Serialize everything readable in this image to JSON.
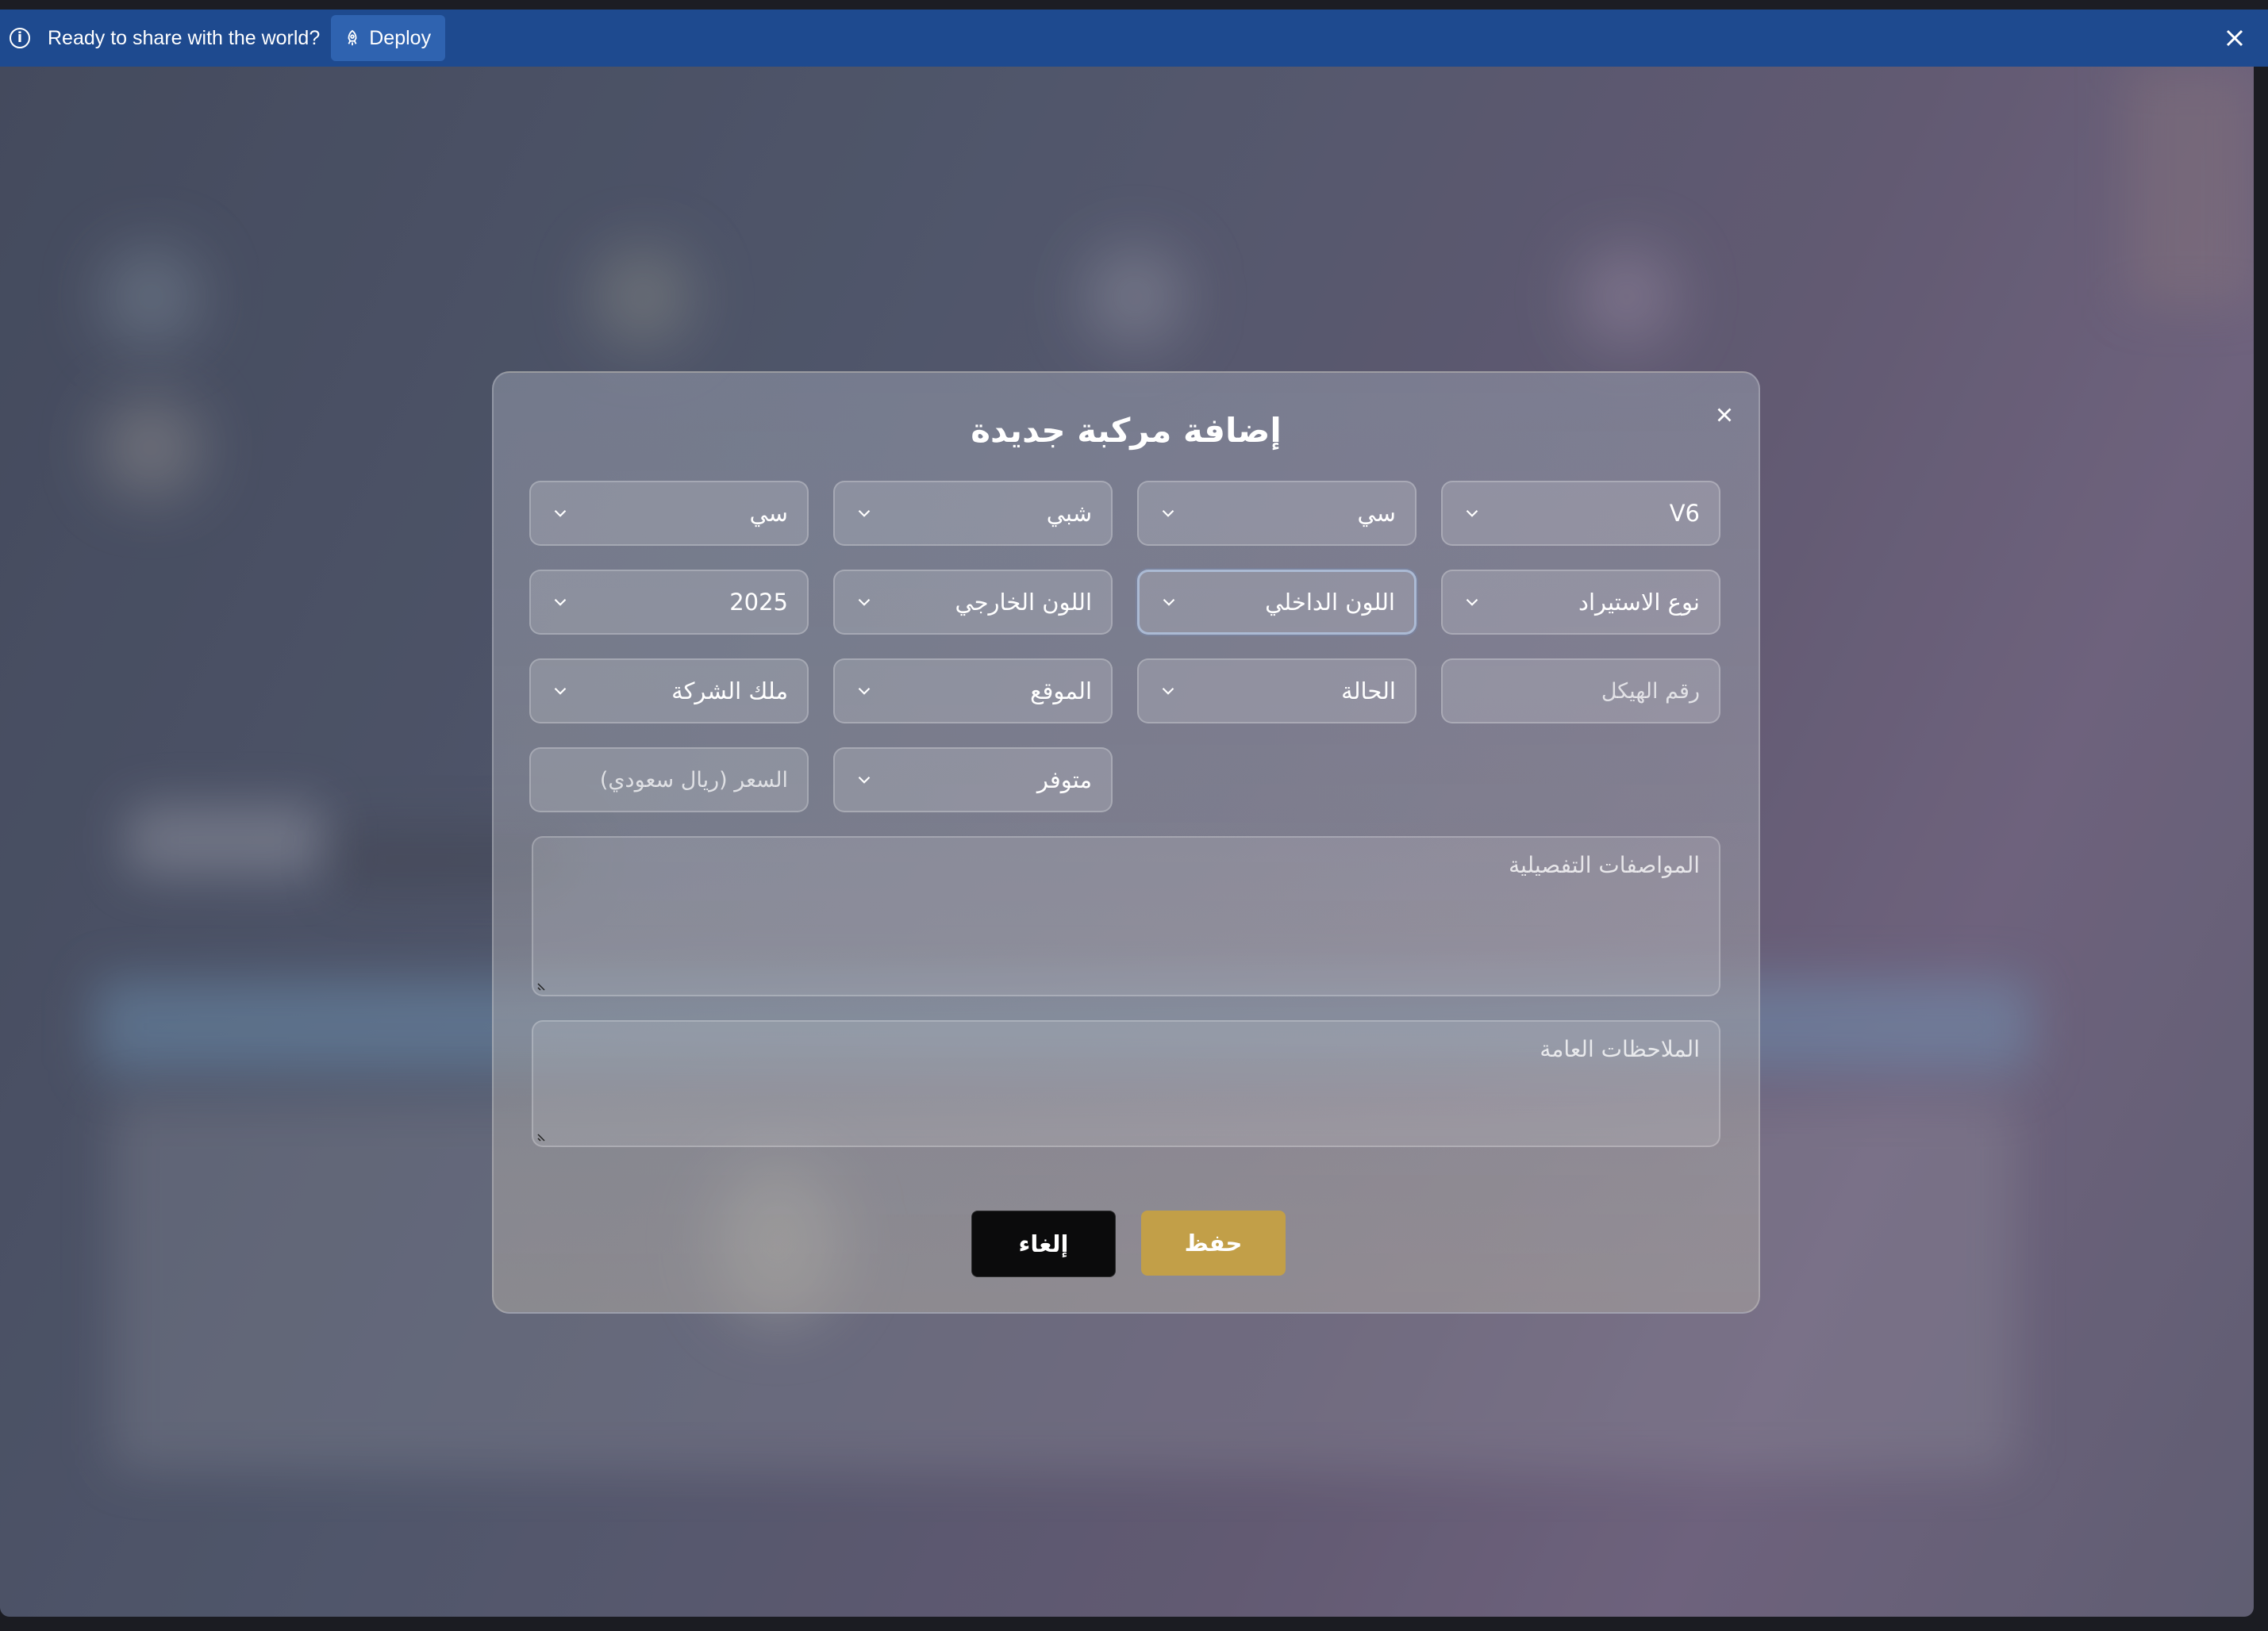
{
  "banner": {
    "message": "Ready to share with the world?",
    "deploy_label": "Deploy"
  },
  "modal": {
    "title": "إضافة مركبة جديدة",
    "rows": [
      [
        "V6",
        "سي",
        "شبي",
        "سي"
      ],
      [
        "نوع الاستيراد",
        "اللون الداخلي",
        "اللون الخارجي",
        "2025"
      ],
      [
        "",
        "الحالة",
        "الموقع",
        "ملك الشركة"
      ],
      [
        "",
        "",
        "متوفر",
        ""
      ]
    ],
    "chassis_placeholder": "رقم الهيكل",
    "price_placeholder": "السعر (ريال سعودي)",
    "specs_placeholder": "المواصفات التفصيلية",
    "notes_placeholder": "الملاحظات العامة",
    "save_label": "حفظ",
    "cancel_label": "إلغاء"
  },
  "colors": {
    "banner": "#1e4a8f",
    "deploy_button": "#2f63b0",
    "save_button": "#c29f48",
    "cancel_button": "#0b0b0c"
  }
}
